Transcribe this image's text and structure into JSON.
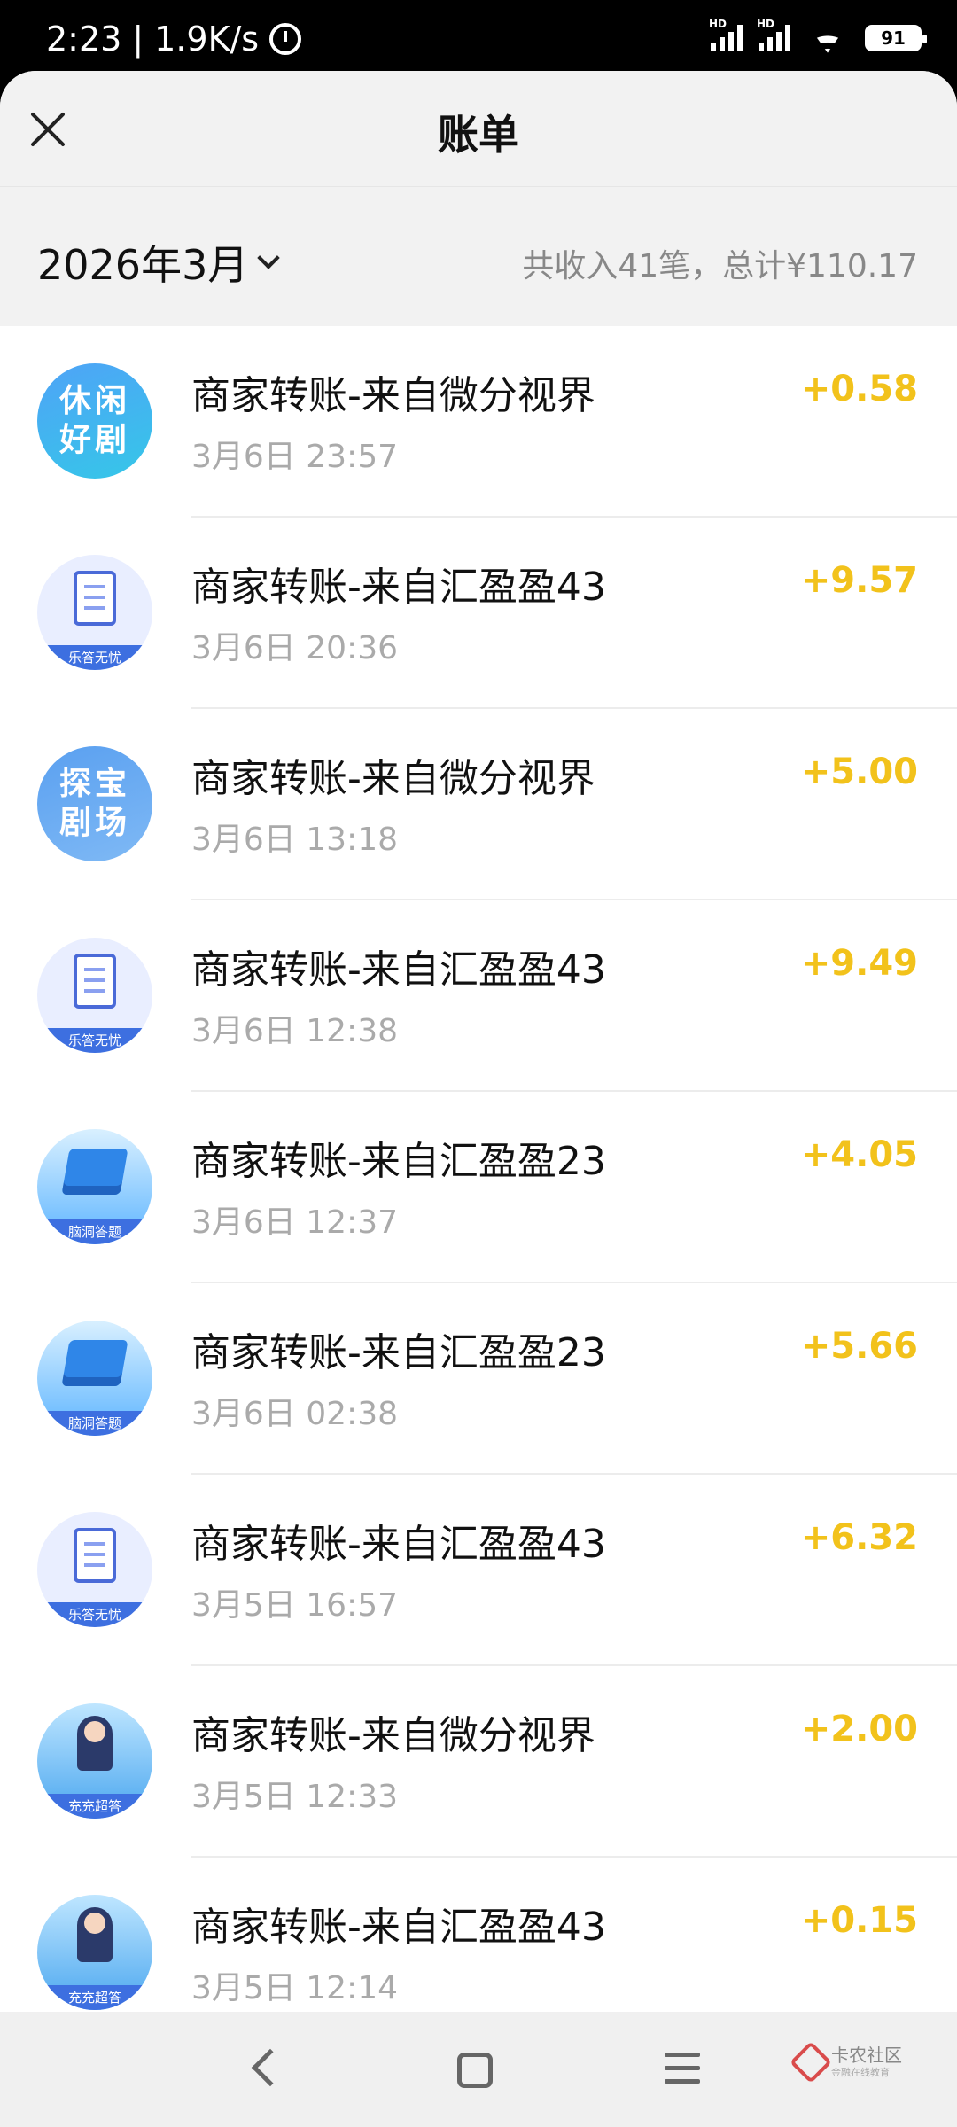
{
  "status_bar": {
    "time": "2:23",
    "speed": "1.9K/s",
    "signal_label": "HD",
    "battery": "91"
  },
  "header": {
    "title": "账单"
  },
  "summary": {
    "month": "2026年3月",
    "total": "共收入41笔，总计¥110.17"
  },
  "transactions": [
    {
      "title": "商家转账-来自微分视界",
      "time": "3月6日 23:57",
      "amount": "+0.58",
      "avatar_text": "休闲好剧",
      "avatar_label": ""
    },
    {
      "title": "商家转账-来自汇盈盈43",
      "time": "3月6日 20:36",
      "amount": "+9.57",
      "avatar_text": "",
      "avatar_label": "乐答无忧"
    },
    {
      "title": "商家转账-来自微分视界",
      "time": "3月6日 13:18",
      "amount": "+5.00",
      "avatar_text": "探宝剧场",
      "avatar_label": ""
    },
    {
      "title": "商家转账-来自汇盈盈43",
      "time": "3月6日 12:38",
      "amount": "+9.49",
      "avatar_text": "",
      "avatar_label": "乐答无忧"
    },
    {
      "title": "商家转账-来自汇盈盈23",
      "time": "3月6日 12:37",
      "amount": "+4.05",
      "avatar_text": "",
      "avatar_label": "脑洞答题"
    },
    {
      "title": "商家转账-来自汇盈盈23",
      "time": "3月6日 02:38",
      "amount": "+5.66",
      "avatar_text": "",
      "avatar_label": "脑洞答题"
    },
    {
      "title": "商家转账-来自汇盈盈43",
      "time": "3月5日 16:57",
      "amount": "+6.32",
      "avatar_text": "",
      "avatar_label": "乐答无忧"
    },
    {
      "title": "商家转账-来自微分视界",
      "time": "3月5日 12:33",
      "amount": "+2.00",
      "avatar_text": "",
      "avatar_label": "充充超答"
    },
    {
      "title": "商家转账-来自汇盈盈43",
      "time": "3月5日 12:14",
      "amount": "+0.15",
      "avatar_text": "",
      "avatar_label": "充充超答"
    }
  ],
  "watermark": {
    "name": "卡农社区",
    "sub": "金融在线教育"
  },
  "colors": {
    "amount": "#f2c21b",
    "background": "#f2f2f2",
    "secondary_text": "#aaaaaa"
  }
}
